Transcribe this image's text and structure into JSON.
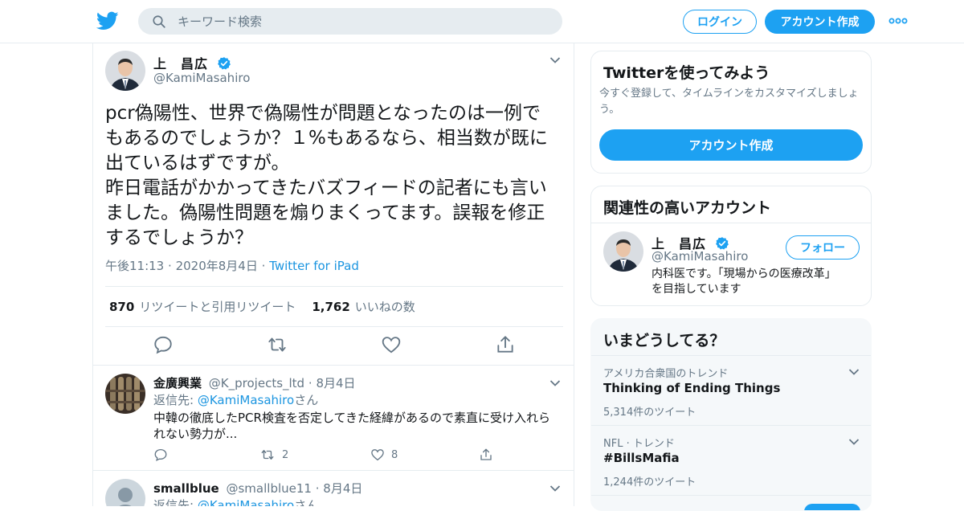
{
  "colors": {
    "accent": "#1da1f2",
    "link": "#1b95e0",
    "secondary_text": "#657786",
    "border": "#e6ecf0",
    "verified": "#1da1f2"
  },
  "header": {
    "logo": "twitter-bird-icon",
    "search_placeholder": "キーワード検索",
    "login_label": "ログイン",
    "signup_label": "アカウント作成",
    "more_icon": "more-dots-icon"
  },
  "tweet": {
    "author_name": "上　昌広",
    "author_handle": "@KamiMasahiro",
    "text": "pcr偽陽性、世界で偽陽性が問題となったのは一例で\nもあるのでしょうか？１%もあるなら、相当数が既に\n出ているはずですが。\n昨日電話がかかってきたバズフィードの記者にも言い\nました。偽陽性問題を煽りまくってます。誤報を修正\nするでしょうか？",
    "time": "午後11:13",
    "date": "2020年8月4日",
    "source": "Twitter for iPad",
    "separator": "·",
    "retweets_count": "870",
    "retweets_label": "リツイートと引用リツイート",
    "likes_count": "1,762",
    "likes_label": "いいねの数"
  },
  "replies": [
    {
      "name": "金廣興業",
      "handle": "@K_projects_ltd",
      "date": "8月4日",
      "reply_prefix": "返信先: ",
      "reply_to": "@KamiMasahiro",
      "reply_suffix": "さん",
      "text": "中韓の徹底したPCR検査を否定してきた経緯があるので素直に受け入れら\nれない勢力が...",
      "retweet_count": "2",
      "like_count": "8"
    },
    {
      "name": "smallblue",
      "handle": "@smallblue11",
      "date": "8月4日",
      "reply_prefix": "返信先: ",
      "reply_to": "@KamiMasahiro",
      "reply_suffix": "さん"
    }
  ],
  "sidebar": {
    "signup_card": {
      "title": "Twitterを使ってみよう",
      "subtitle": "今すぐ登録して、タイムラインをカスタマイズしましょ\nう。",
      "button": "アカウント作成"
    },
    "related_card": {
      "title": "関連性の高いアカウント",
      "name": "上　昌広",
      "handle": "@KamiMasahiro",
      "follow_label": "フォロー",
      "bio": "内科医です。「現場からの医療改革」\nを目指しています"
    },
    "trends_card": {
      "title": "いまどうしてる？",
      "items": [
        {
          "context": "アメリカ合衆国のトレンド",
          "name": "Thinking of Ending Things",
          "count": "5,314件のツイート"
        },
        {
          "context": "NFL · トレンド",
          "name": "#BillsMafia",
          "count": "1,244件のツイート"
        }
      ]
    }
  }
}
